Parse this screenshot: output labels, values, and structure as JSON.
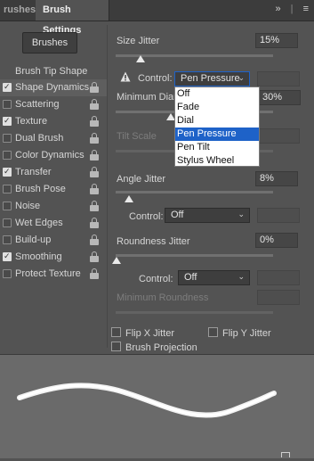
{
  "tabs": {
    "brushes_tab": "rushes",
    "settings_tab": "Brush Settings"
  },
  "header_icons": {
    "expand": "»",
    "menu": "≡"
  },
  "left": {
    "brushes_button": "Brushes",
    "brush_tip_shape": "Brush Tip Shape",
    "options": [
      {
        "label": "Shape Dynamics",
        "checked": true,
        "highlighted": true
      },
      {
        "label": "Scattering",
        "checked": false
      },
      {
        "label": "Texture",
        "checked": true
      },
      {
        "label": "Dual Brush",
        "checked": false
      },
      {
        "label": "Color Dynamics",
        "checked": false
      },
      {
        "label": "Transfer",
        "checked": true
      },
      {
        "label": "Brush Pose",
        "checked": false
      },
      {
        "label": "Noise",
        "checked": false
      },
      {
        "label": "Wet Edges",
        "checked": false
      },
      {
        "label": "Build-up",
        "checked": false
      },
      {
        "label": "Smoothing",
        "checked": true
      },
      {
        "label": "Protect Texture",
        "checked": false
      }
    ]
  },
  "right": {
    "size_jitter": {
      "label": "Size Jitter",
      "value": "15%",
      "level": 0.15
    },
    "control1": {
      "label": "Control:",
      "value": "Pen Pressure"
    },
    "min_diameter": {
      "label": "Minimum Diam",
      "value": "30%"
    },
    "tilt_scale": {
      "label": "Tilt Scale"
    },
    "angle_jitter": {
      "label": "Angle Jitter",
      "value": "8%",
      "level": 0.08
    },
    "control2": {
      "label": "Control:",
      "value": "Off"
    },
    "roundness_jitter": {
      "label": "Roundness Jitter",
      "value": "0%",
      "level": 0.0
    },
    "control3": {
      "label": "Control:",
      "value": "Off"
    },
    "min_roundness": {
      "label": "Minimum Roundness"
    },
    "flip_x": "Flip X Jitter",
    "flip_y": "Flip Y Jitter",
    "projection": "Brush Projection"
  },
  "dropdown": {
    "options": [
      "Off",
      "Fade",
      "Dial",
      "Pen Pressure",
      "Pen Tilt",
      "Stylus Wheel"
    ],
    "selected": "Pen Pressure"
  },
  "colors": {
    "panel": "#535353",
    "tabbar": "#3c3c3c",
    "selection": "#1e62c8"
  }
}
